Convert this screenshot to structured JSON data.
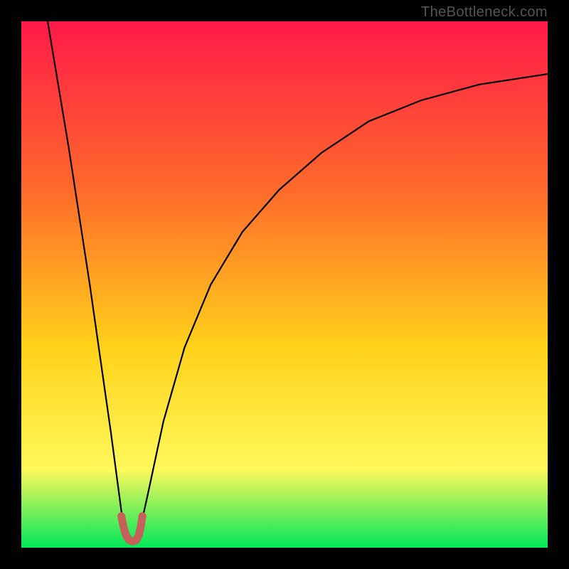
{
  "watermark": "TheBottleneck.com",
  "colors": {
    "top": "#ff1a49",
    "upper_mid": "#ff6a2b",
    "mid": "#ffd21a",
    "lower_mid": "#fff85a",
    "bottom": "#00e85a",
    "curve": "#000000",
    "marker": "#c6605a",
    "border": "#000000"
  },
  "chart_data": {
    "type": "line",
    "title": "",
    "xlabel": "",
    "ylabel": "",
    "xlim": [
      0,
      100
    ],
    "ylim": [
      0,
      100
    ],
    "legend": [],
    "annotations": [],
    "series": [
      {
        "name": "left-branch",
        "x": [
          5,
          7,
          9,
          11,
          13,
          15,
          17,
          19,
          20
        ],
        "values": [
          100,
          88,
          76,
          63,
          50,
          36,
          22,
          7,
          1
        ]
      },
      {
        "name": "right-branch",
        "x": [
          22,
          24,
          27,
          31,
          36,
          42,
          49,
          57,
          66,
          76,
          87,
          100
        ],
        "values": [
          1,
          10,
          24,
          38,
          50,
          60,
          68,
          75,
          81,
          85,
          88,
          90
        ]
      }
    ],
    "marker": {
      "name": "u-marker",
      "x": [
        19,
        19.4,
        19.9,
        20.5,
        21.2,
        21.8,
        22.3,
        22.7,
        23
      ],
      "values": [
        6,
        4,
        2.3,
        1.4,
        1.2,
        1.4,
        2.3,
        4,
        6
      ]
    }
  }
}
